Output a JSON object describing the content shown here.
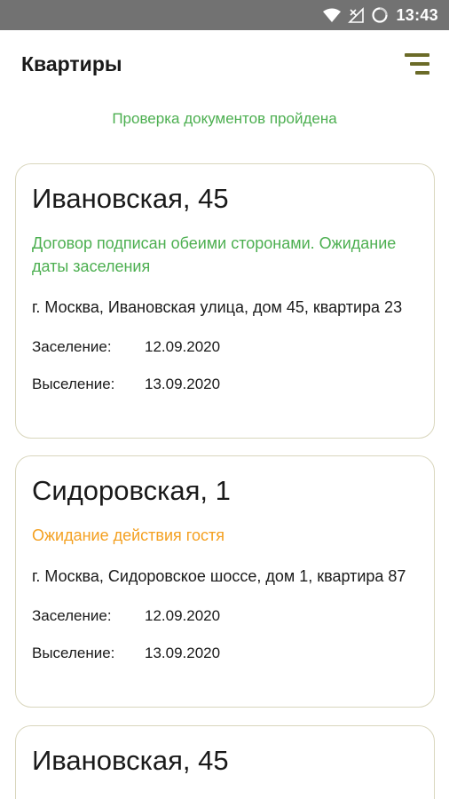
{
  "status_bar": {
    "time": "13:43",
    "icons": [
      "wifi-icon",
      "signal-off-icon",
      "battery-icon"
    ]
  },
  "app_bar": {
    "title": "Квартиры",
    "menu_icon": "menu-icon"
  },
  "check_status": "Проверка документов пройдена",
  "colors": {
    "status_green": "#4caf50",
    "status_orange": "#f4a020",
    "menu_olive": "#6b6b28",
    "card_border": "#d9d6bd"
  },
  "apartments": [
    {
      "title": "Ивановская, 45",
      "status": "Договор подписан обеими сторонами. Ожидание даты заселения",
      "status_color": "green",
      "address": "г. Москва, Ивановская улица, дом 45, квартира 23",
      "checkin_label": "Заселение:",
      "checkin_date": "12.09.2020",
      "checkout_label": "Выселение:",
      "checkout_date": "13.09.2020"
    },
    {
      "title": "Сидоровская, 1",
      "status": "Ожидание действия гостя",
      "status_color": "orange",
      "address": "г. Москва, Сидоровское шоссе, дом 1, квартира 87",
      "checkin_label": "Заселение:",
      "checkin_date": "12.09.2020",
      "checkout_label": "Выселение:",
      "checkout_date": "13.09.2020"
    },
    {
      "title": "Ивановская, 45"
    }
  ]
}
